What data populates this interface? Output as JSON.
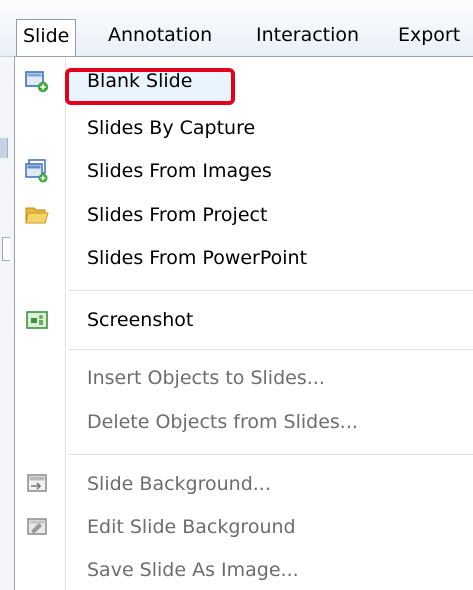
{
  "menubar": {
    "items": [
      {
        "label": "Slide",
        "active": true
      },
      {
        "label": "Annotation"
      },
      {
        "label": "Interaction"
      },
      {
        "label": "Export"
      }
    ]
  },
  "menu": {
    "items": [
      {
        "label": "Blank Slide",
        "icon": "blank-slide-icon",
        "highlighted": true
      },
      {
        "label": "Slides By Capture"
      },
      {
        "label": "Slides From Images",
        "icon": "images-icon"
      },
      {
        "label": "Slides From Project",
        "icon": "folder-icon"
      },
      {
        "label": "Slides From PowerPoint"
      },
      {
        "label": "Screenshot",
        "icon": "screenshot-icon"
      },
      {
        "label": "Insert Objects to Slides...",
        "disabled": true
      },
      {
        "label": "Delete Objects from Slides...",
        "disabled": true
      },
      {
        "label": "Slide Background...",
        "icon": "slide-background-icon",
        "disabled": true
      },
      {
        "label": "Edit Slide Background",
        "icon": "edit-background-icon",
        "disabled": true
      },
      {
        "label": "Save Slide As Image...",
        "disabled": true
      }
    ]
  },
  "colors": {
    "highlight_border": "#e3001b",
    "disabled_text": "#6d6d6d"
  }
}
